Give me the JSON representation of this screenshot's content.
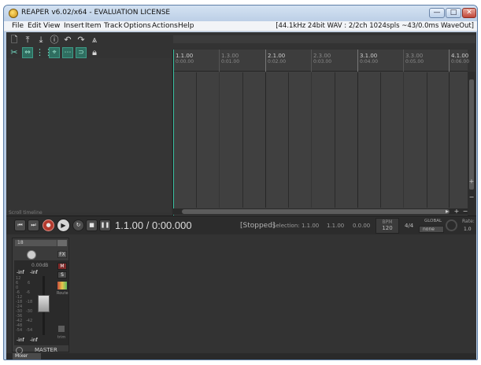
{
  "window": {
    "title": "REAPER v6.02/x64 - EVALUATION LICENSE",
    "minimize": "—",
    "maximize": "□",
    "close": "✕"
  },
  "menu": [
    "File",
    "Edit",
    "View",
    "Insert",
    "Item",
    "Track",
    "Options",
    "Actions",
    "Help"
  ],
  "status_info": "[44.1kHz 24bit WAV : 2/2ch 1024spls ~43/0.0ms WaveOut]",
  "timeline": {
    "markers": [
      {
        "main": "1.1.00",
        "sub": "0:00.00",
        "major": true
      },
      {
        "main": "1.3.00",
        "sub": "0:01.00",
        "major": false
      },
      {
        "main": "2.1.00",
        "sub": "0:02.00",
        "major": true
      },
      {
        "main": "2.3.00",
        "sub": "0:03.00",
        "major": false
      },
      {
        "main": "3.1.00",
        "sub": "0:04.00",
        "major": true
      },
      {
        "main": "3.3.00",
        "sub": "0:05.00",
        "major": false
      },
      {
        "main": "4.1.00",
        "sub": "0:06.00",
        "major": true
      }
    ],
    "scroll_label": "Scroll timeline"
  },
  "transport": {
    "position": "1.1.00 / 0:00.000",
    "state": "[Stopped]",
    "selection_label": "Selection:",
    "selection_start": "1.1.00",
    "selection_end": "1.1.00",
    "selection_length": "0.0.00",
    "bpm_label": "BPM",
    "bpm": "120",
    "time_sig": "4/4",
    "global_label": "GLOBAL",
    "global_mode": "none",
    "rate_label": "Rate:",
    "rate": "1.0"
  },
  "master": {
    "input_value": "18",
    "volume_db": "0.00dB",
    "peak_left": "-inf",
    "peak_right": "-inf",
    "foot_left": "-inf",
    "foot_right": "-inf",
    "mute_label": "M",
    "solo_label": "S",
    "fx_label": "FX",
    "route_label": "Route",
    "trim_label": "trim",
    "name": "MASTER",
    "meter_ticks_left": [
      "12",
      "6",
      "0",
      "-6",
      "-12",
      "-18",
      "-24",
      "-30",
      "-36",
      "-42",
      "-48",
      "-54"
    ],
    "meter_ticks_mid": [
      "6",
      "-6",
      "-18",
      "-30",
      "-42",
      "-54"
    ]
  },
  "dock": {
    "tab_label": "Mixer"
  }
}
